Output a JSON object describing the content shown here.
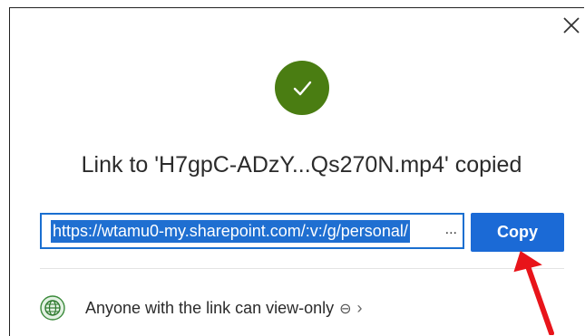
{
  "dialog": {
    "title": "Link to 'H7gpC-ADzY...Qs270N.mp4' copied",
    "link_value": "https://wtamu0-my.sharepoint.com/:v:/g/personal/",
    "link_ellipsis": "...",
    "copy_label": "Copy",
    "permission_text": "Anyone with the link can view-only",
    "permission_minus": "⊖",
    "permission_chevron": "›"
  },
  "icons": {
    "close": "close-icon",
    "success": "checkmark-icon",
    "globe": "globe-icon",
    "annotation": "red-arrow-icon"
  },
  "colors": {
    "success": "#4a7d12",
    "accent": "#1b6ad6",
    "annotation_arrow": "#e8141a"
  }
}
